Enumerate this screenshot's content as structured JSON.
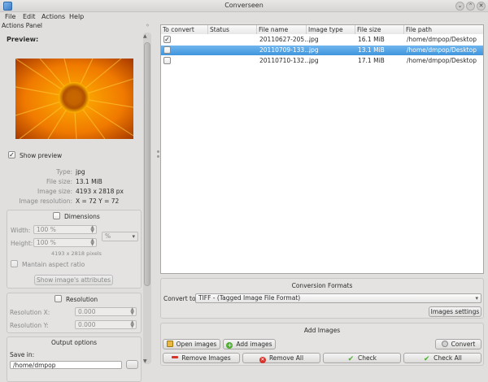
{
  "window": {
    "title": "Converseen"
  },
  "menu": [
    "File",
    "Edit",
    "Actions",
    "Help"
  ],
  "dock": {
    "title": "Actions Panel",
    "close": "◦",
    "preview_label": "Preview:",
    "show_preview": "Show preview",
    "info": {
      "type_label": "Type:",
      "type_value": "jpg",
      "filesize_label": "File size:",
      "filesize_value": "13.1 MiB",
      "imagesize_label": "Image size:",
      "imagesize_value": "4193 x 2818 px",
      "resolution_label": "Image resolution:",
      "resolution_value": "X = 72 Y = 72"
    },
    "dimensions": {
      "title": "Dimensions",
      "width_label": "Width:",
      "width_value": "100 %",
      "height_label": "Height:",
      "height_value": "100 %",
      "unit": "%",
      "pixels_note": "4193 x 2818 pixels",
      "aspect_label": "Mantain aspect ratio",
      "attributes_button": "Show image's attributes"
    },
    "resolution": {
      "title": "Resolution",
      "x_label": "Resolution X:",
      "x_value": "0.000",
      "y_label": "Resolution Y:",
      "y_value": "0.000"
    },
    "output": {
      "title": "Output options",
      "save_in_label": "Save in:",
      "save_in_value": "/home/dmpop"
    }
  },
  "table": {
    "headers": [
      "To convert",
      "Status",
      "File name",
      "Image type",
      "File size",
      "File path"
    ],
    "rows": [
      {
        "checked": true,
        "status": "",
        "name": "20110627-205...",
        "type": "jpg",
        "size": "16.1 MiB",
        "path": "/home/dmpop/Desktop",
        "selected": false
      },
      {
        "checked": false,
        "status": "",
        "name": "20110709-133...",
        "type": "jpg",
        "size": "13.1 MiB",
        "path": "/home/dmpop/Desktop",
        "selected": true
      },
      {
        "checked": false,
        "status": "",
        "name": "20110710-132...",
        "type": "jpg",
        "size": "17.1 MiB",
        "path": "/home/dmpop/Desktop",
        "selected": false
      }
    ]
  },
  "conversion": {
    "title": "Conversion Formats",
    "convert_to_label": "Convert to:",
    "format": "TIFF - (Tagged Image File Format)",
    "settings_button": "Images settings"
  },
  "add_images": {
    "title": "Add Images",
    "open_button": "Open images",
    "add_button": "Add images",
    "convert_button": "Convert",
    "remove_button": "Remove Images",
    "remove_all_button": "Remove All",
    "check_button": "Check",
    "check_all_button": "Check All"
  },
  "colors": {
    "selection": "#3f95dd",
    "accent_green": "#4caf30",
    "accent_red": "#d9342b"
  }
}
